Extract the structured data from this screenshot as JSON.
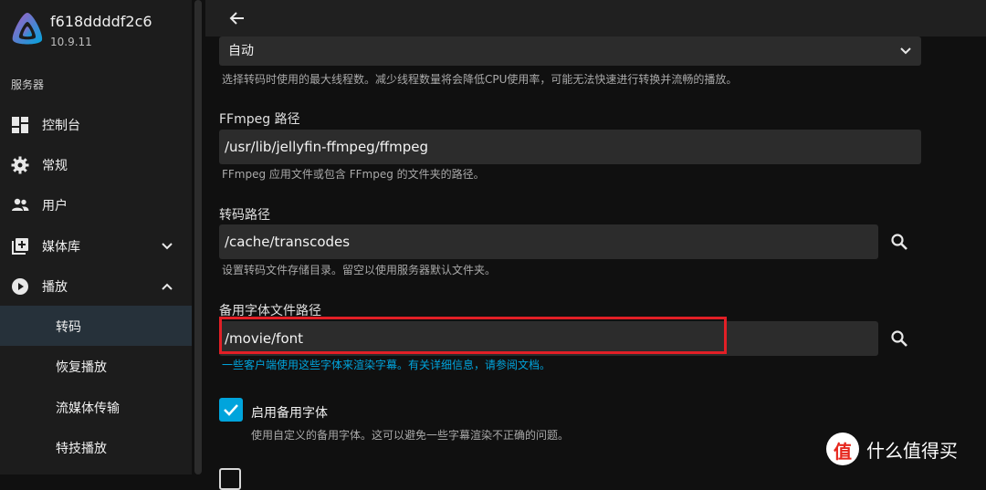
{
  "brand": {
    "server_name": "f618ddddf2c6",
    "version": "10.9.11"
  },
  "sidebar": {
    "section_label": "服务器",
    "items": [
      {
        "label": "控制台",
        "icon": "dashboard-icon"
      },
      {
        "label": "常规",
        "icon": "gear-icon"
      },
      {
        "label": "用户",
        "icon": "users-icon"
      },
      {
        "label": "媒体库",
        "icon": "library-add-icon",
        "expanded": false
      },
      {
        "label": "播放",
        "icon": "play-circle-icon",
        "expanded": true
      }
    ],
    "sub_items": [
      {
        "label": "转码",
        "active": true
      },
      {
        "label": "恢复播放",
        "active": false
      },
      {
        "label": "流媒体传输",
        "active": false
      },
      {
        "label": "特技播放",
        "active": false
      }
    ]
  },
  "main": {
    "thread_select_value": "自动",
    "thread_help": "选择转码时使用的最大线程数。减少线程数量将会降低CPU使用率，可能无法快速进行转换并流畅的播放。",
    "ffmpeg": {
      "label": "FFmpeg 路径",
      "value": "/usr/lib/jellyfin-ffmpeg/ffmpeg",
      "help": "FFmpeg 应用文件或包含 FFmpeg 的文件夹的路径。"
    },
    "transcode": {
      "label": "转码路径",
      "value": "/cache/transcodes",
      "help": "设置转码文件存储目录。留空以使用服务器默认文件夹。"
    },
    "fallback_font": {
      "label": "备用字体文件路径",
      "value": "/movie/font",
      "help_link": "一些客户端使用这些字体来渲染字幕。有关详细信息，请参阅文档。"
    },
    "enable_fallback": {
      "label": "启用备用字体",
      "help": "使用自定义的备用字体。这可以避免一些字幕渲染不正确的问题。",
      "checked": true
    }
  },
  "watermark": {
    "logo_char": "值",
    "text": "什么值得买"
  },
  "colors": {
    "accent": "#00a4dc",
    "highlight_box": "#e21f26",
    "sidebar_bg": "#1c1c1c",
    "active_bg": "#26313a"
  }
}
